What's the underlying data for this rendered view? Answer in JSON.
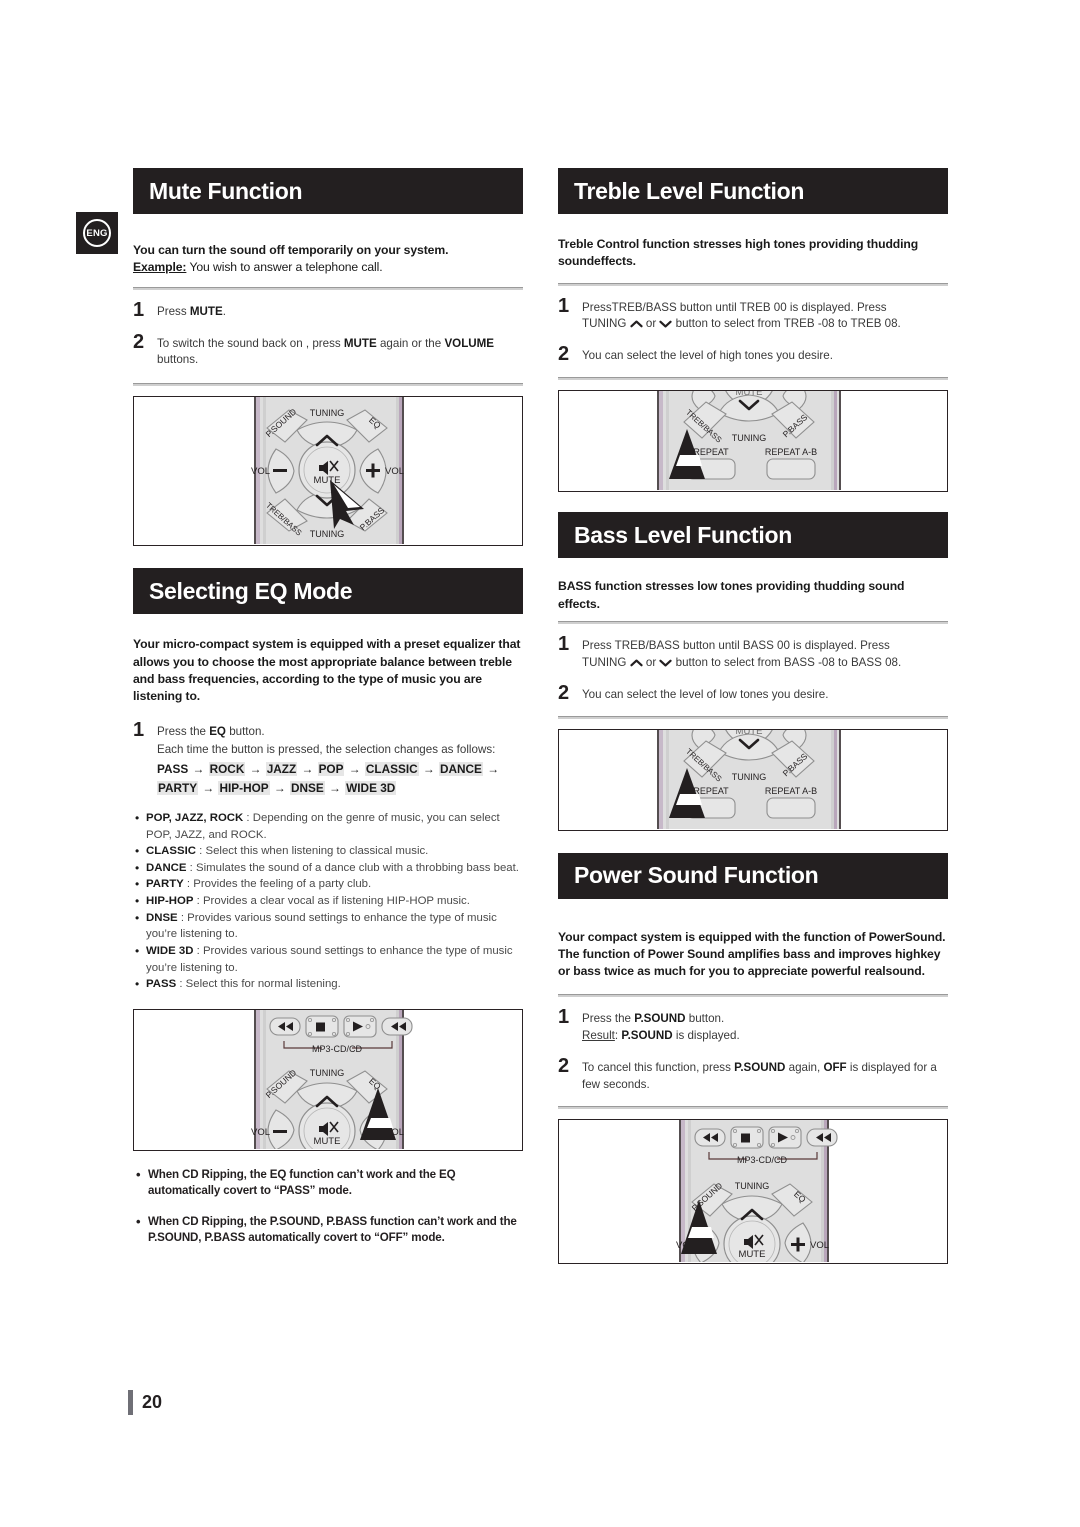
{
  "page": {
    "language_badge": "ENG",
    "page_number": "20"
  },
  "left_column": {
    "mute": {
      "title": "Mute Function",
      "intro_bold": "You can turn the sound off temporarily on your system.",
      "example_label": "Example:",
      "example_text": " You wish to answer a telephone call.",
      "steps": [
        {
          "num": "1",
          "text_pre": "Press ",
          "text_bold": "MUTE",
          "text_post": "."
        },
        {
          "num": "2",
          "text_pre": "To switch the sound back on , press ",
          "text_bold": "MUTE",
          "text_mid": " again or the ",
          "text_bold2": "VOLUME",
          "text_post": " buttons."
        }
      ],
      "illustration": {
        "name": "remote-dpad-mute",
        "labels": [
          "P.SOUND",
          "TUNING",
          "EQ",
          "VOL",
          "MUTE",
          "VOL",
          "TREB/BASS",
          "TUNING",
          "P.BASS"
        ]
      }
    },
    "eq": {
      "title": "Selecting  EQ Mode",
      "intro": "Your micro-compact system is equipped with a preset equalizer that allows you to choose the most appropriate balance between treble and bass frequencies, according to the type of music you are listening to.",
      "step1_num": "1",
      "step1_pre": "Press the ",
      "step1_bold": "EQ",
      "step1_post": " button.",
      "step1_sub": "Each time the button is pressed, the selection changes as follows:",
      "chain": [
        "PASS",
        "ROCK",
        "JAZZ",
        "POP",
        "CLASSIC",
        "DANCE",
        "PARTY",
        "HIP-HOP",
        "DNSE",
        "WIDE 3D"
      ],
      "chain_highlight": [
        false,
        true,
        true,
        true,
        true,
        true,
        true,
        true,
        true,
        true
      ],
      "arrow": "→",
      "bullets": [
        {
          "term": "POP, JAZZ, ROCK",
          "desc": " : Depending on the genre of music, you can select POP, JAZZ, and ROCK."
        },
        {
          "term": "CLASSIC",
          "desc": " : Select this when listening to classical music."
        },
        {
          "term": "DANCE",
          "desc": " : Simulates the sound of a dance club with a throbbing bass beat."
        },
        {
          "term": "PARTY",
          "desc": " : Provides the feeling of a party club."
        },
        {
          "term": "HIP-HOP",
          "desc": " : Provides a clear vocal as if listening HIP-HOP music."
        },
        {
          "term": "DNSE",
          "desc": " : Provides various sound settings to enhance the type of music you’re listening to."
        },
        {
          "term": "WIDE 3D",
          "desc": " : Provides various sound settings to enhance the type of music you’re listening to."
        },
        {
          "term": "PASS",
          "desc": " : Select this for normal listening."
        }
      ],
      "illustration": {
        "name": "remote-transport-eq",
        "labels": [
          "MP3-CD/CD",
          "P.SOUND",
          "TUNING",
          "EQ",
          "VOL",
          "MUTE",
          "VOL"
        ]
      },
      "notes": [
        "When CD Ripping, the EQ function can’t work and the EQ automatically covert to “PASS” mode.",
        "When CD Ripping, the P.SOUND, P.BASS function can’t work and the  P.SOUND, P.BASS automatically covert to “OFF” mode."
      ]
    }
  },
  "right_column": {
    "treble": {
      "title": "Treble Level Function",
      "intro": "Treble Control function stresses high tones providing thudding soundeffects.",
      "steps": [
        {
          "num": "1",
          "line1_a": "PressTREB/BASS  button until TREB 00 is displayed. Press",
          "line2_a": "TUNING ",
          "line2_b": " or ",
          "line2_c": " button to select from TREB -08 to TREB 08."
        },
        {
          "num": "2",
          "text": "You can select the level of high tones you desire."
        }
      ],
      "illustration": {
        "name": "remote-trebbass-pointer",
        "labels": [
          "TREB/BASS",
          "TUNING",
          "P.BASS",
          "REPEAT",
          "REPEAT A-B"
        ]
      }
    },
    "bass": {
      "title": "Bass Level Function",
      "intro": "BASS function stresses low tones providing thudding sound effects.",
      "steps": [
        {
          "num": "1",
          "line1_a": "Press TREB/BASS  button until  BASS 00 is displayed.  Press",
          "line2_a": "TUNING ",
          "line2_b": " or ",
          "line2_c": " button to select from BASS -08 to BASS  08."
        },
        {
          "num": "2",
          "text": "You can select the level of low tones you desire."
        }
      ],
      "illustration": {
        "name": "remote-trebbass-pointer-2",
        "labels": [
          "TREB/BASS",
          "TUNING",
          "P.BASS",
          "REPEAT",
          "REPEAT A-B"
        ]
      }
    },
    "power_sound": {
      "title": "Power Sound Function",
      "intro_line1": "Your compact system is equipped with the function of PowerSound.",
      "intro_line2": "The function of Power Sound amplifies bass and improves highkey or bass twice as much for you to appreciate powerful realsound.",
      "steps": [
        {
          "num": "1",
          "line1_pre": "Press the ",
          "line1_bold": "P.SOUND",
          "line1_post": " button.",
          "line2_label": "Result",
          "line2_colon": ":  ",
          "line2_bold": "P.SOUND",
          "line2_post": "  is displayed."
        },
        {
          "num": "2",
          "pre": "To cancel this function, press ",
          "bold": "P.SOUND",
          "mid": " again,  ",
          "bold2": "OFF",
          "post": "  is displayed for a few seconds."
        }
      ],
      "illustration": {
        "name": "remote-psound-pointer",
        "labels": [
          "MP3-CD/CD",
          "P.SOUND",
          "TUNING",
          "EQ",
          "VOL",
          "MUTE",
          "VOL"
        ]
      }
    }
  },
  "colors": {
    "header_bg": "#231f20",
    "header_text": "#ffffff",
    "body_text": "#3a3a3a",
    "highlight": "#e6e6e6",
    "remote_body": "#dcdcdc",
    "remote_key": "#e9e9e9"
  }
}
